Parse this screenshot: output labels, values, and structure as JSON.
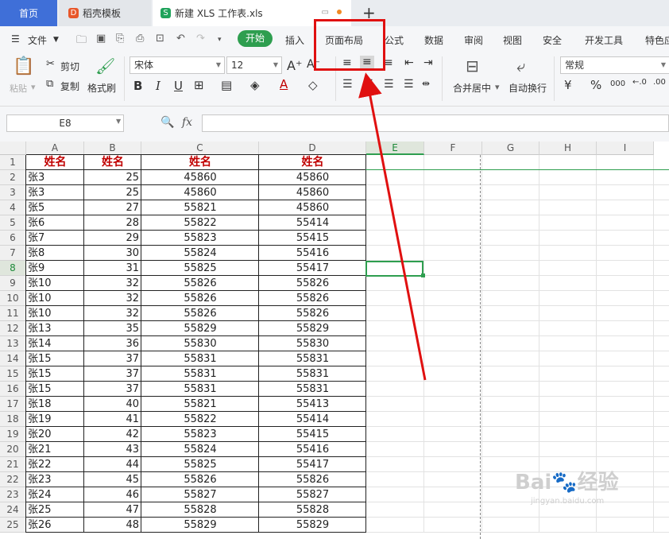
{
  "tabs": {
    "home": "首页",
    "template": "稻壳模板",
    "file": "新建 XLS 工作表.xls",
    "new_tab": "+"
  },
  "menu": {
    "file": "文件",
    "start": "开始",
    "insert": "插入",
    "page_layout": "页面布局",
    "formula": "公式",
    "data": "数据",
    "review": "审阅",
    "view": "视图",
    "security": "安全",
    "developer": "开发工具",
    "special": "特色应"
  },
  "ribbon": {
    "paste": "粘贴",
    "cut": "剪切",
    "copy": "复制",
    "format_painter": "格式刷",
    "font_name": "宋体",
    "font_size": "12",
    "merge_center": "合并居中",
    "wrap_text": "自动换行",
    "number_format": "常规",
    "bold": "B",
    "italic": "I",
    "underline": "U",
    "percent": "%",
    "comma": "000"
  },
  "formula_bar": {
    "name_box": "E8",
    "fx": "fx",
    "value": ""
  },
  "columns": [
    "A",
    "B",
    "C",
    "D",
    "E",
    "F",
    "G",
    "H",
    "I"
  ],
  "selected_cell": "E8",
  "header_row": [
    "姓名",
    "姓名",
    "姓名",
    "姓名"
  ],
  "rows": [
    [
      "张3",
      "25",
      "45860",
      "45860"
    ],
    [
      "张3",
      "25",
      "45860",
      "45860"
    ],
    [
      "张5",
      "27",
      "55821",
      "45860"
    ],
    [
      "张6",
      "28",
      "55822",
      "55414"
    ],
    [
      "张7",
      "29",
      "55823",
      "55415"
    ],
    [
      "张8",
      "30",
      "55824",
      "55416"
    ],
    [
      "张9",
      "31",
      "55825",
      "55417"
    ],
    [
      "张10",
      "32",
      "55826",
      "55826"
    ],
    [
      "张10",
      "32",
      "55826",
      "55826"
    ],
    [
      "张10",
      "32",
      "55826",
      "55826"
    ],
    [
      "张13",
      "35",
      "55829",
      "55829"
    ],
    [
      "张14",
      "36",
      "55830",
      "55830"
    ],
    [
      "张15",
      "37",
      "55831",
      "55831"
    ],
    [
      "张15",
      "37",
      "55831",
      "55831"
    ],
    [
      "张15",
      "37",
      "55831",
      "55831"
    ],
    [
      "张18",
      "40",
      "55821",
      "55413"
    ],
    [
      "张19",
      "41",
      "55822",
      "55414"
    ],
    [
      "张20",
      "42",
      "55823",
      "55415"
    ],
    [
      "张21",
      "43",
      "55824",
      "55416"
    ],
    [
      "张22",
      "44",
      "55825",
      "55417"
    ],
    [
      "张23",
      "45",
      "55826",
      "55826"
    ],
    [
      "张24",
      "46",
      "55827",
      "55827"
    ],
    [
      "张25",
      "47",
      "55828",
      "55828"
    ],
    [
      "张26",
      "48",
      "55829",
      "55829"
    ]
  ],
  "row_numbers": [
    "1",
    "2",
    "3",
    "4",
    "5",
    "6",
    "7",
    "8",
    "9",
    "10",
    "11",
    "12",
    "13",
    "14",
    "15",
    "16",
    "17",
    "18",
    "19",
    "20",
    "21",
    "22",
    "23",
    "24",
    "25"
  ],
  "watermark": {
    "main": "Bai🐾经验",
    "sub": "jingyan.baidu.com"
  },
  "colors": {
    "accent_green": "#2e9e4f",
    "header_text": "#c00000",
    "annotation_red": "#e01010",
    "home_tab": "#3f6fd8"
  }
}
